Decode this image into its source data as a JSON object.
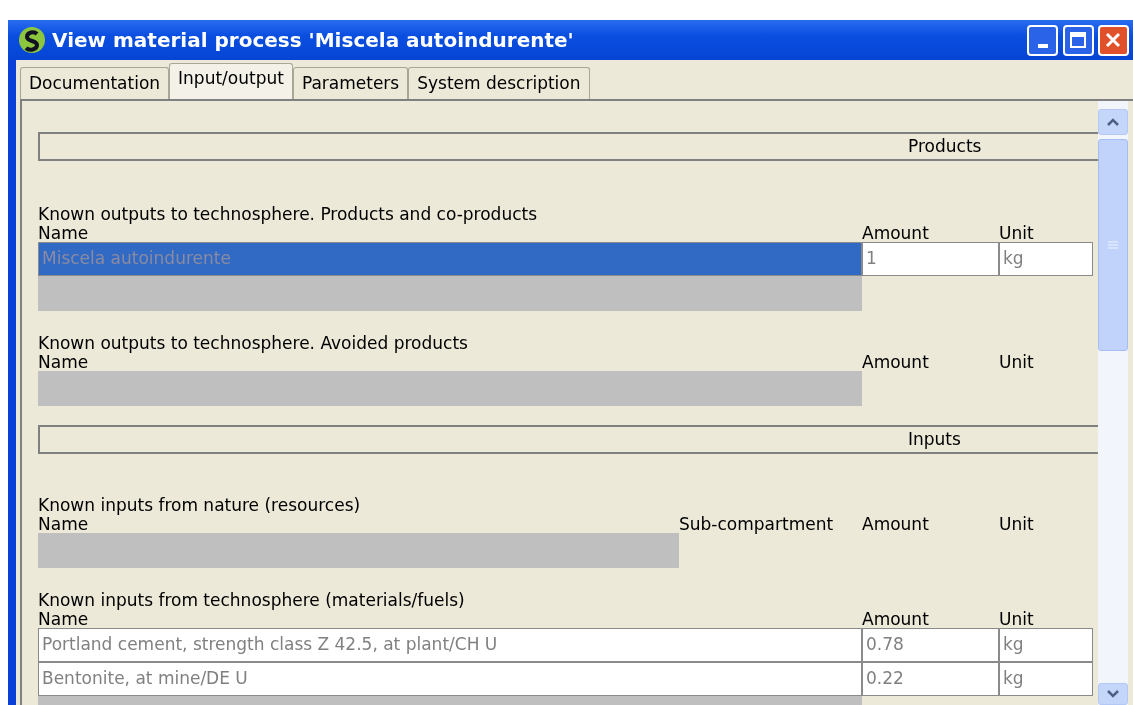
{
  "window": {
    "title": "View material process 'Miscela autoindurente'"
  },
  "tabs": [
    {
      "label": "Documentation",
      "selected": false
    },
    {
      "label": "Input/output",
      "selected": true
    },
    {
      "label": "Parameters",
      "selected": false
    },
    {
      "label": "System description",
      "selected": false
    }
  ],
  "sections": [
    {
      "kind": "header",
      "label": "Products"
    },
    {
      "kind": "group",
      "title": "Known outputs to technosphere. Products and co-products",
      "columns": [
        "Name",
        "Amount",
        "Unit"
      ],
      "rows": [
        {
          "name": "Miscela autoindurente",
          "amount": "1",
          "unit": "kg",
          "selected": true
        }
      ]
    },
    {
      "kind": "group",
      "title": "Known outputs to technosphere. Avoided products",
      "columns": [
        "Name",
        "Amount",
        "Unit"
      ]
    },
    {
      "kind": "header",
      "label": "Inputs"
    },
    {
      "kind": "group",
      "title": "Known inputs from nature (resources)",
      "columns": [
        "Name",
        "Sub-compartment",
        "Amount",
        "Unit"
      ]
    },
    {
      "kind": "group",
      "title": "Known inputs from technosphere (materials/fuels)",
      "columns": [
        "Name",
        "Amount",
        "Unit"
      ],
      "rows": [
        {
          "name": "Portland cement, strength class Z 42.5, at plant/CH U",
          "amount": "0.78",
          "unit": "kg",
          "selected": false
        },
        {
          "name": "Bentonite, at mine/DE U",
          "amount": "0.22",
          "unit": "kg",
          "selected": false
        }
      ]
    }
  ]
}
